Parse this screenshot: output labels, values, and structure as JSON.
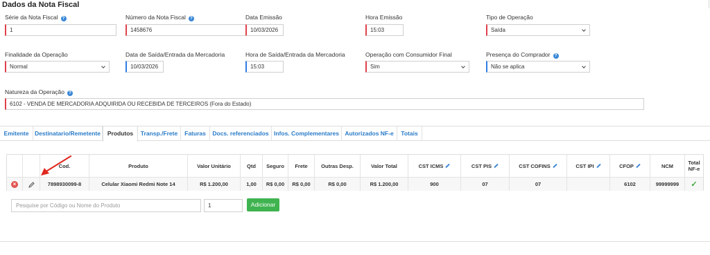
{
  "section_title": "Dados da Nota Fiscal",
  "fields": {
    "serie": {
      "label": "Série da Nota Fiscal",
      "value": "1"
    },
    "numero": {
      "label": "Número da Nota Fiscal",
      "value": "1458676"
    },
    "data_emissao": {
      "label": "Data Emissão",
      "value": "10/03/2026"
    },
    "hora_emissao": {
      "label": "Hora Emissão",
      "value": "15:03"
    },
    "tipo_operacao": {
      "label": "Tipo de Operação",
      "value": "Saída"
    },
    "finalidade": {
      "label": "Finalidade da Operação",
      "value": "Normal"
    },
    "data_saida": {
      "label": "Data de Saída/Entrada da Mercadoria",
      "value": "10/03/2026"
    },
    "hora_saida": {
      "label": "Hora de Saída/Entrada da Mercadoria",
      "value": "15:03"
    },
    "consumidor_final": {
      "label": "Operação com Consumidor Final",
      "value": "Sim"
    },
    "presenca": {
      "label": "Presença do Comprador",
      "value": "Não se aplica"
    },
    "natureza": {
      "label": "Natureza da Operação",
      "value": "6102 - VENDA DE MERCADORIA ADQUIRIDA OU RECEBIDA DE TERCEIROS (Fora do Estado)"
    }
  },
  "help_icon_glyph": "?",
  "tabs": [
    "Emitente",
    "Destinatario/Remetente",
    "Produtos",
    "Transp./Frete",
    "Faturas",
    "Docs. referenciados",
    "Infos. Complementares",
    "Autorizados NF-e",
    "Totais"
  ],
  "active_tab": "Produtos",
  "table": {
    "headers": {
      "cod": "Cod.",
      "produto": "Produto",
      "valor_unitario": "Valor Unitário",
      "qtd": "Qtd",
      "seguro": "Seguro",
      "frete": "Frete",
      "outras": "Outras Desp.",
      "valor_total": "Valor Total",
      "cst_icms": "CST ICMS",
      "cst_pis": "CST PIS",
      "cst_cofins": "CST COFINS",
      "cst_ipi": "CST IPI",
      "cfop": "CFOP",
      "ncm": "NCM",
      "total_nfe_1": "Total",
      "total_nfe_2": "NF-e"
    },
    "row": {
      "cod": "7898930099-8",
      "produto": "Celular Xiaomi Redmi Note 14",
      "valor_unitario": "R$ 1.200,00",
      "qtd": "1,00",
      "seguro": "R$ 0,00",
      "frete": "R$ 0,00",
      "outras": "R$ 0,00",
      "valor_total": "R$ 1.200,00",
      "cst_icms": "900",
      "cst_pis": "07",
      "cst_cofins": "07",
      "cst_ipi": "",
      "cfop": "6102",
      "ncm": "99999999",
      "delete_glyph": "×",
      "check_glyph": "✓"
    }
  },
  "add_product": {
    "search_placeholder": "Pesquise por Código ou Nome do Produto",
    "qty_value": "1",
    "button_label": "Adicionar"
  },
  "icons": {
    "help": "question-circle-icon",
    "edit_column": "pencil-icon",
    "delete_row": "remove-circle-icon",
    "edit_row": "pencil-icon",
    "total_check": "check-icon",
    "annotation": "red-arrow-icon"
  },
  "colors": {
    "required_border": "#e0404a",
    "optional_border": "#2f7de1",
    "tab_link": "#2a7bc8",
    "add_button": "#3fb34f",
    "arrow": "#e0281f"
  }
}
